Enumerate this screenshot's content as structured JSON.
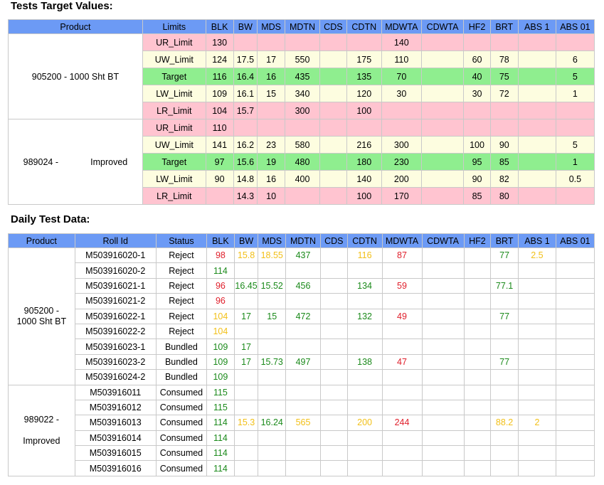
{
  "titles": {
    "target": "Tests Target Values:",
    "daily": "Daily Test Data:"
  },
  "target": {
    "headers": [
      "Product",
      "Limits",
      "BLK",
      "BW",
      "MDS",
      "MDTN",
      "CDS",
      "CDTN",
      "MDWTA",
      "CDWTA",
      "HF2",
      "BRT",
      "ABS 1",
      "ABS 01"
    ],
    "groups": [
      {
        "product": "905200 - 1000 Sht BT",
        "rows": [
          {
            "limit": "UR_Limit",
            "type": "red",
            "values": [
              "130",
              "",
              "",
              "",
              "",
              "",
              "140",
              "",
              "",
              "",
              "",
              ""
            ]
          },
          {
            "limit": "UW_Limit",
            "type": "yel",
            "values": [
              "124",
              "17.5",
              "17",
              "550",
              "",
              "175",
              "110",
              "",
              "60",
              "78",
              "",
              "6"
            ]
          },
          {
            "limit": "Target",
            "type": "grn",
            "values": [
              "116",
              "16.4",
              "16",
              "435",
              "",
              "135",
              "70",
              "",
              "40",
              "75",
              "",
              "5"
            ]
          },
          {
            "limit": "LW_Limit",
            "type": "yel",
            "values": [
              "109",
              "16.1",
              "15",
              "340",
              "",
              "120",
              "30",
              "",
              "30",
              "72",
              "",
              "1"
            ]
          },
          {
            "limit": "LR_Limit",
            "type": "red",
            "values": [
              "104",
              "15.7",
              "",
              "300",
              "",
              "100",
              "",
              "",
              "",
              "",
              "",
              ""
            ]
          }
        ]
      },
      {
        "product": "989024 -             Improved",
        "rows": [
          {
            "limit": "UR_Limit",
            "type": "red",
            "values": [
              "110",
              "",
              "",
              "",
              "",
              "",
              "",
              "",
              "",
              "",
              "",
              ""
            ]
          },
          {
            "limit": "UW_Limit",
            "type": "yel",
            "values": [
              "141",
              "16.2",
              "23",
              "580",
              "",
              "216",
              "300",
              "",
              "100",
              "90",
              "",
              "5"
            ]
          },
          {
            "limit": "Target",
            "type": "grn",
            "values": [
              "97",
              "15.6",
              "19",
              "480",
              "",
              "180",
              "230",
              "",
              "95",
              "85",
              "",
              "1"
            ]
          },
          {
            "limit": "LW_Limit",
            "type": "yel",
            "values": [
              "90",
              "14.8",
              "16",
              "400",
              "",
              "140",
              "200",
              "",
              "90",
              "82",
              "",
              "0.5"
            ]
          },
          {
            "limit": "LR_Limit",
            "type": "red",
            "values": [
              "",
              "14.3",
              "10",
              "",
              "",
              "100",
              "170",
              "",
              "85",
              "80",
              "",
              ""
            ]
          }
        ]
      }
    ]
  },
  "daily": {
    "headers": [
      "Product",
      "Roll Id",
      "Status",
      "BLK",
      "BW",
      "MDS",
      "MDTN",
      "CDS",
      "CDTN",
      "MDWTA",
      "CDWTA",
      "HF2",
      "BRT",
      "ABS 1",
      "ABS 01"
    ],
    "groups": [
      {
        "product_lines": [
          "905200 -",
          "1000 Sht BT"
        ],
        "rows": [
          {
            "roll": "M503916020-1",
            "status": "Reject",
            "cells": [
              [
                "98",
                "red"
              ],
              [
                "15.8",
                "yel"
              ],
              [
                "18.55",
                "yel"
              ],
              [
                "437",
                "grn"
              ],
              [
                "",
                ""
              ],
              [
                "116",
                "yel"
              ],
              [
                "87",
                "red"
              ],
              [
                "",
                ""
              ],
              [
                "",
                ""
              ],
              [
                "77",
                "grn"
              ],
              [
                "2.5",
                "yel"
              ],
              [
                "",
                ""
              ]
            ]
          },
          {
            "roll": "M503916020-2",
            "status": "Reject",
            "cells": [
              [
                "114",
                "grn"
              ],
              [
                "",
                ""
              ],
              [
                "",
                ""
              ],
              [
                "",
                ""
              ],
              [
                "",
                ""
              ],
              [
                "",
                ""
              ],
              [
                "",
                ""
              ],
              [
                "",
                ""
              ],
              [
                "",
                ""
              ],
              [
                "",
                ""
              ],
              [
                "",
                ""
              ],
              [
                "",
                ""
              ]
            ]
          },
          {
            "roll": "M503916021-1",
            "status": "Reject",
            "cells": [
              [
                "96",
                "red"
              ],
              [
                "16.45",
                "grn"
              ],
              [
                "15.52",
                "grn"
              ],
              [
                "456",
                "grn"
              ],
              [
                "",
                ""
              ],
              [
                "134",
                "grn"
              ],
              [
                "59",
                "red"
              ],
              [
                "",
                ""
              ],
              [
                "",
                ""
              ],
              [
                "77.1",
                "grn"
              ],
              [
                "",
                ""
              ],
              [
                "",
                ""
              ]
            ]
          },
          {
            "roll": "M503916021-2",
            "status": "Reject",
            "cells": [
              [
                "96",
                "red"
              ],
              [
                "",
                ""
              ],
              [
                "",
                ""
              ],
              [
                "",
                ""
              ],
              [
                "",
                ""
              ],
              [
                "",
                ""
              ],
              [
                "",
                ""
              ],
              [
                "",
                ""
              ],
              [
                "",
                ""
              ],
              [
                "",
                ""
              ],
              [
                "",
                ""
              ],
              [
                "",
                ""
              ]
            ]
          },
          {
            "roll": "M503916022-1",
            "status": "Reject",
            "cells": [
              [
                "104",
                "yel"
              ],
              [
                "17",
                "grn"
              ],
              [
                "15",
                "grn"
              ],
              [
                "472",
                "grn"
              ],
              [
                "",
                ""
              ],
              [
                "132",
                "grn"
              ],
              [
                "49",
                "red"
              ],
              [
                "",
                ""
              ],
              [
                "",
                ""
              ],
              [
                "77",
                "grn"
              ],
              [
                "",
                ""
              ],
              [
                "",
                ""
              ]
            ]
          },
          {
            "roll": "M503916022-2",
            "status": "Reject",
            "cells": [
              [
                "104",
                "yel"
              ],
              [
                "",
                ""
              ],
              [
                "",
                ""
              ],
              [
                "",
                ""
              ],
              [
                "",
                ""
              ],
              [
                "",
                ""
              ],
              [
                "",
                ""
              ],
              [
                "",
                ""
              ],
              [
                "",
                ""
              ],
              [
                "",
                ""
              ],
              [
                "",
                ""
              ],
              [
                "",
                ""
              ]
            ]
          },
          {
            "roll": "M503916023-1",
            "status": "Bundled",
            "cells": [
              [
                "109",
                "grn"
              ],
              [
                "17",
                "grn"
              ],
              [
                "",
                ""
              ],
              [
                "",
                ""
              ],
              [
                "",
                ""
              ],
              [
                "",
                ""
              ],
              [
                "",
                ""
              ],
              [
                "",
                ""
              ],
              [
                "",
                ""
              ],
              [
                "",
                ""
              ],
              [
                "",
                ""
              ],
              [
                "",
                ""
              ]
            ]
          },
          {
            "roll": "M503916023-2",
            "status": "Bundled",
            "cells": [
              [
                "109",
                "grn"
              ],
              [
                "17",
                "grn"
              ],
              [
                "15.73",
                "grn"
              ],
              [
                "497",
                "grn"
              ],
              [
                "",
                ""
              ],
              [
                "138",
                "grn"
              ],
              [
                "47",
                "red"
              ],
              [
                "",
                ""
              ],
              [
                "",
                ""
              ],
              [
                "77",
                "grn"
              ],
              [
                "",
                ""
              ],
              [
                "",
                ""
              ]
            ]
          },
          {
            "roll": "M503916024-2",
            "status": "Bundled",
            "cells": [
              [
                "109",
                "grn"
              ],
              [
                "",
                ""
              ],
              [
                "",
                ""
              ],
              [
                "",
                ""
              ],
              [
                "",
                ""
              ],
              [
                "",
                ""
              ],
              [
                "",
                ""
              ],
              [
                "",
                ""
              ],
              [
                "",
                ""
              ],
              [
                "",
                ""
              ],
              [
                "",
                ""
              ],
              [
                "",
                ""
              ]
            ]
          }
        ]
      },
      {
        "product_lines": [
          "989022 -",
          "",
          "Improved"
        ],
        "rows": [
          {
            "roll": "M503916011",
            "status": "Consumed",
            "cells": [
              [
                "115",
                "grn"
              ],
              [
                "",
                ""
              ],
              [
                "",
                ""
              ],
              [
                "",
                ""
              ],
              [
                "",
                ""
              ],
              [
                "",
                ""
              ],
              [
                "",
                ""
              ],
              [
                "",
                ""
              ],
              [
                "",
                ""
              ],
              [
                "",
                ""
              ],
              [
                "",
                ""
              ],
              [
                "",
                ""
              ]
            ]
          },
          {
            "roll": "M503916012",
            "status": "Consumed",
            "cells": [
              [
                "115",
                "grn"
              ],
              [
                "",
                ""
              ],
              [
                "",
                ""
              ],
              [
                "",
                ""
              ],
              [
                "",
                ""
              ],
              [
                "",
                ""
              ],
              [
                "",
                ""
              ],
              [
                "",
                ""
              ],
              [
                "",
                ""
              ],
              [
                "",
                ""
              ],
              [
                "",
                ""
              ],
              [
                "",
                ""
              ]
            ]
          },
          {
            "roll": "M503916013",
            "status": "Consumed",
            "cells": [
              [
                "114",
                "grn"
              ],
              [
                "15.3",
                "yel"
              ],
              [
                "16.24",
                "grn"
              ],
              [
                "565",
                "yel"
              ],
              [
                "",
                ""
              ],
              [
                "200",
                "yel"
              ],
              [
                "244",
                "red"
              ],
              [
                "",
                ""
              ],
              [
                "",
                ""
              ],
              [
                "88.2",
                "yel"
              ],
              [
                "2",
                "yel"
              ],
              [
                "",
                ""
              ]
            ]
          },
          {
            "roll": "M503916014",
            "status": "Consumed",
            "cells": [
              [
                "114",
                "grn"
              ],
              [
                "",
                ""
              ],
              [
                "",
                ""
              ],
              [
                "",
                ""
              ],
              [
                "",
                ""
              ],
              [
                "",
                ""
              ],
              [
                "",
                ""
              ],
              [
                "",
                ""
              ],
              [
                "",
                ""
              ],
              [
                "",
                ""
              ],
              [
                "",
                ""
              ],
              [
                "",
                ""
              ]
            ]
          },
          {
            "roll": "M503916015",
            "status": "Consumed",
            "cells": [
              [
                "114",
                "grn"
              ],
              [
                "",
                ""
              ],
              [
                "",
                ""
              ],
              [
                "",
                ""
              ],
              [
                "",
                ""
              ],
              [
                "",
                ""
              ],
              [
                "",
                ""
              ],
              [
                "",
                ""
              ],
              [
                "",
                ""
              ],
              [
                "",
                ""
              ],
              [
                "",
                ""
              ],
              [
                "",
                ""
              ]
            ]
          },
          {
            "roll": "M503916016",
            "status": "Consumed",
            "cells": [
              [
                "114",
                "grn"
              ],
              [
                "",
                ""
              ],
              [
                "",
                ""
              ],
              [
                "",
                ""
              ],
              [
                "",
                ""
              ],
              [
                "",
                ""
              ],
              [
                "",
                ""
              ],
              [
                "",
                ""
              ],
              [
                "",
                ""
              ],
              [
                "",
                ""
              ],
              [
                "",
                ""
              ],
              [
                "",
                ""
              ]
            ]
          }
        ]
      }
    ]
  }
}
